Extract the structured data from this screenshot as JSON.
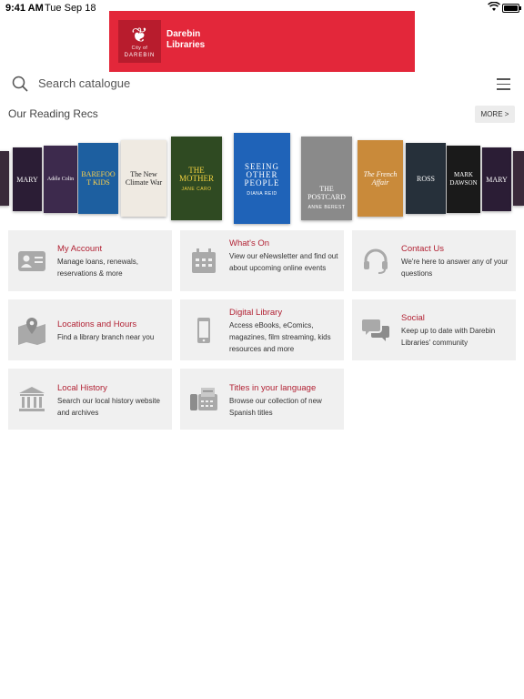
{
  "status_bar": {
    "time": "9:41 AM",
    "date": "Tue Sep 18",
    "battery_level": 1.0
  },
  "banner": {
    "logo_text_small": "City of",
    "logo_text_city": "DAREBIN",
    "brand_line1": "Darebin",
    "brand_line2": "Libraries",
    "color": "#e3273a"
  },
  "search": {
    "placeholder": "Search catalogue",
    "value": ""
  },
  "recs": {
    "title": "Our Reading Recs",
    "more_label": "MORE >",
    "books": [
      {
        "title": "",
        "author": ""
      },
      {
        "title": "MARY",
        "author": ""
      },
      {
        "title": "Adéle Colin",
        "author": ""
      },
      {
        "title": "BAREFOOT KIDS",
        "author": ""
      },
      {
        "title": "The New Climate War",
        "author": ""
      },
      {
        "title": "THE MOTHER",
        "author": "JANE CARO"
      },
      {
        "title": "SEEING OTHER PEOPLE",
        "author": "DIANA REID"
      },
      {
        "title": "THE POSTCARD",
        "author": "ANNE BEREST"
      },
      {
        "title": "The French Affair",
        "author": ""
      },
      {
        "title": "ROSS",
        "author": ""
      },
      {
        "title": "MARK DAWSON",
        "author": ""
      },
      {
        "title": "MARY",
        "author": ""
      },
      {
        "title": "",
        "author": ""
      }
    ]
  },
  "tiles": [
    {
      "icon": "contact-card-icon",
      "title": "My Account",
      "desc": "Manage loans, renewals, reservations & more"
    },
    {
      "icon": "calendar-icon",
      "title": "What's On",
      "desc": "View our eNewsletter and find out about upcoming online events"
    },
    {
      "icon": "headset-icon",
      "title": "Contact Us",
      "desc": "We're here to answer any of your questions"
    },
    {
      "icon": "map-pin-icon",
      "title": "Locations and Hours",
      "desc": "Find a library branch near you"
    },
    {
      "icon": "phone-icon",
      "title": "Digital Library",
      "desc": "Access eBooks, eComics, magazines, film streaming, kids resources and more"
    },
    {
      "icon": "chat-bubbles-icon",
      "title": "Social",
      "desc": "Keep up to date with Darebin Libraries' community"
    },
    {
      "icon": "library-building-icon",
      "title": "Local History",
      "desc": "Search our local history website and archives"
    },
    {
      "icon": "fax-machine-icon",
      "title": "Titles in your language",
      "desc": "Browse our collection of new Spanish titles"
    }
  ],
  "colors": {
    "accent": "#b22234",
    "tile_bg": "#f0f0f0"
  }
}
